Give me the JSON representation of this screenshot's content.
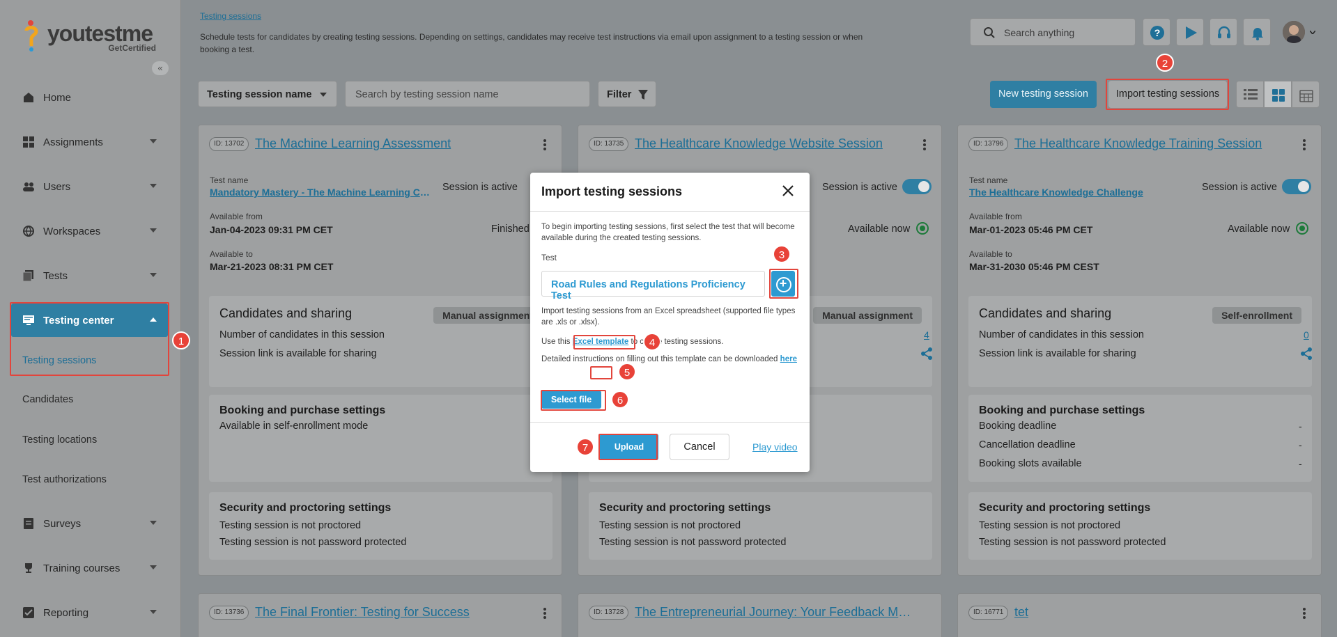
{
  "brand": {
    "name": "youtestme",
    "sub": "GetCertified"
  },
  "sidebar": {
    "items": [
      {
        "label": "Home"
      },
      {
        "label": "Assignments"
      },
      {
        "label": "Users"
      },
      {
        "label": "Workspaces"
      },
      {
        "label": "Tests"
      },
      {
        "label": "Testing center"
      },
      {
        "label": "Surveys"
      },
      {
        "label": "Training courses"
      },
      {
        "label": "Reporting"
      }
    ],
    "sub_items": [
      {
        "label": "Testing sessions"
      },
      {
        "label": "Candidates"
      },
      {
        "label": "Testing locations"
      },
      {
        "label": "Test authorizations"
      }
    ]
  },
  "header": {
    "breadcrumb": "Testing sessions",
    "description": "Schedule tests for candidates by creating testing sessions. Depending on settings, candidates may receive test instructions via email upon assignment to a testing session or when booking a test.",
    "search_placeholder": "Search anything"
  },
  "toolbar": {
    "select_value": "Testing session name",
    "search_placeholder": "Search by testing session name",
    "filter_label": "Filter",
    "new_label": "New testing session",
    "import_label": "Import testing sessions"
  },
  "cards": [
    {
      "id": "ID: 13702",
      "title": "The Machine Learning Assessment",
      "test_name_label": "Test name",
      "test_name": "Mandatory Mastery - The Machine Learning Challenge",
      "active_label": "Session is active",
      "from_label": "Available from",
      "from": "Jan-04-2023 09:31 PM CET",
      "status": "Finished",
      "to_label": "Available to",
      "to": "Mar-21-2023 08:31 PM CET",
      "cand_title": "Candidates and sharing",
      "badge": "Manual assignment",
      "num_label": "Number of candidates in this session",
      "num": "",
      "share_label": "Session link is available for sharing",
      "booking_title": "Booking and purchase settings",
      "booking_text": "Available in self-enrollment mode",
      "sec_title": "Security and proctoring settings",
      "sec1": "Testing session is not proctored",
      "sec2": "Testing session is not password protected"
    },
    {
      "id": "ID: 13735",
      "title": "The Healthcare Knowledge Website Session",
      "active_label": "Session is active",
      "status": "Available now",
      "badge": "Manual assignment",
      "num": "4",
      "sec_title": "Security and proctoring settings",
      "sec1": "Testing session is not proctored",
      "sec2": "Testing session is not password protected"
    },
    {
      "id": "ID: 13796",
      "title": "The Healthcare Knowledge Training Session",
      "test_name_label": "Test name",
      "test_name": "The Healthcare Knowledge Challenge",
      "active_label": "Session is active",
      "from_label": "Available from",
      "from": "Mar-01-2023 05:46 PM CET",
      "status": "Available now",
      "to_label": "Available to",
      "to": "Mar-31-2030 05:46 PM CEST",
      "cand_title": "Candidates and sharing",
      "badge": "Self-enrollment",
      "num_label": "Number of candidates in this session",
      "num": "0",
      "share_label": "Session link is available for sharing",
      "booking_title": "Booking and purchase settings",
      "booking_deadline": "Booking deadline",
      "cancel_deadline": "Cancellation deadline",
      "slots": "Booking slots available",
      "dash": "-",
      "sec_title": "Security and proctoring settings",
      "sec1": "Testing session is not proctored",
      "sec2": "Testing session is not password protected"
    }
  ],
  "cards_row2": [
    {
      "id": "ID: 13736",
      "title": "The Final Frontier: Testing for Success"
    },
    {
      "id": "ID: 13728",
      "title": "The Entrepreneurial Journey: Your Feedback Matters"
    },
    {
      "id": "ID: 16771",
      "title": "tet"
    }
  ],
  "modal": {
    "title": "Import testing sessions",
    "intro": "To begin importing testing sessions, first select the test that will become available during the created testing sessions.",
    "test_label": "Test",
    "test_value": "Road Rules and Regulations Proficiency Test",
    "import_text": "Import testing sessions from an Excel spreadsheet (supported file types are .xls or .xlsx).",
    "use_this": "Use this",
    "template_link": "Excel template",
    "use_this_after": "to create testing sessions.",
    "detail_text": "Detailed instructions on filling out this template can be downloaded",
    "here_link": "here",
    "select_file": "Select file",
    "upload": "Upload",
    "cancel": "Cancel",
    "play_video": "Play video"
  },
  "steps": [
    "1",
    "2",
    "3",
    "4",
    "5",
    "6",
    "7"
  ]
}
